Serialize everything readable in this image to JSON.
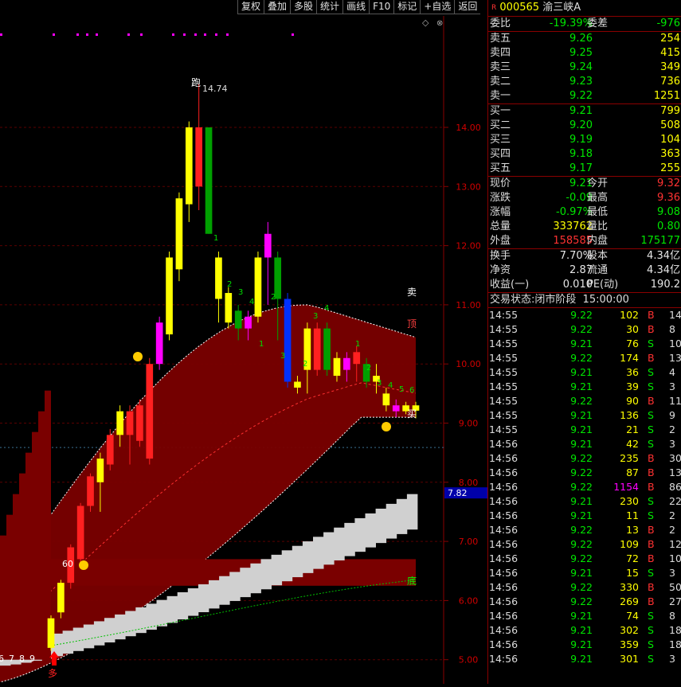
{
  "toolbar": [
    "复权",
    "叠加",
    "多股",
    "统计",
    "画线",
    "F10",
    "标记",
    "+自选",
    "返回"
  ],
  "stock": {
    "badge": "R",
    "code": "000565",
    "name": "渝三峡A"
  },
  "summary": [
    {
      "l1": "委比",
      "v1": "-19.39%",
      "c1": "green",
      "l2": "委差",
      "v2": "-976",
      "c2": "green"
    }
  ],
  "sell": [
    {
      "label": "卖五",
      "price": "9.26",
      "vol": "254"
    },
    {
      "label": "卖四",
      "price": "9.25",
      "vol": "415"
    },
    {
      "label": "卖三",
      "price": "9.24",
      "vol": "349"
    },
    {
      "label": "卖二",
      "price": "9.23",
      "vol": "736"
    },
    {
      "label": "卖一",
      "price": "9.22",
      "vol": "1251"
    }
  ],
  "buy": [
    {
      "label": "买一",
      "price": "9.21",
      "vol": "799"
    },
    {
      "label": "买二",
      "price": "9.20",
      "vol": "508"
    },
    {
      "label": "买三",
      "price": "9.19",
      "vol": "104"
    },
    {
      "label": "买四",
      "price": "9.18",
      "vol": "363"
    },
    {
      "label": "买五",
      "price": "9.17",
      "vol": "255"
    }
  ],
  "quote": [
    {
      "l1": "现价",
      "v1": "9.21",
      "c1": "green",
      "l2": "今开",
      "v2": "9.32",
      "c2": "red"
    },
    {
      "l1": "涨跌",
      "v1": "-0.09",
      "c1": "green",
      "l2": "最高",
      "v2": "9.36",
      "c2": "red"
    },
    {
      "l1": "涨幅",
      "v1": "-0.97%",
      "c1": "green",
      "l2": "最低",
      "v2": "9.08",
      "c2": "green"
    },
    {
      "l1": "总量",
      "v1": "333762",
      "c1": "yellow",
      "l2": "量比",
      "v2": "0.80",
      "c2": "green"
    },
    {
      "l1": "外盘",
      "v1": "158585",
      "c1": "red",
      "l2": "内盘",
      "v2": "175177",
      "c2": "green"
    }
  ],
  "fund": [
    {
      "l1": "换手",
      "v1": "7.70%",
      "l2": "股本",
      "v2": "4.34亿"
    },
    {
      "l1": "净资",
      "v1": "2.87",
      "l2": "流通",
      "v2": "4.34亿"
    },
    {
      "l1": "收益(一)",
      "v1": "0.010",
      "l2": "PE(动)",
      "v2": "190.2"
    }
  ],
  "status": {
    "label": "交易状态:",
    "value": "闭市阶段",
    "time": "15:00:00"
  },
  "trades": [
    [
      "14:55",
      "9.22",
      "102",
      "B",
      "14"
    ],
    [
      "14:55",
      "9.22",
      "30",
      "B",
      "8"
    ],
    [
      "14:55",
      "9.21",
      "76",
      "S",
      "10"
    ],
    [
      "14:55",
      "9.22",
      "174",
      "B",
      "13"
    ],
    [
      "14:55",
      "9.21",
      "36",
      "S",
      "4"
    ],
    [
      "14:55",
      "9.21",
      "39",
      "S",
      "3"
    ],
    [
      "14:55",
      "9.22",
      "90",
      "B",
      "11"
    ],
    [
      "14:55",
      "9.21",
      "136",
      "S",
      "9"
    ],
    [
      "14:55",
      "9.21",
      "21",
      "S",
      "2"
    ],
    [
      "14:56",
      "9.21",
      "42",
      "S",
      "3"
    ],
    [
      "14:56",
      "9.22",
      "235",
      "B",
      "30"
    ],
    [
      "14:56",
      "9.22",
      "87",
      "B",
      "13"
    ],
    [
      "14:56",
      "9.22",
      "1154",
      "B",
      "86"
    ],
    [
      "14:56",
      "9.21",
      "230",
      "S",
      "22"
    ],
    [
      "14:56",
      "9.21",
      "11",
      "S",
      "2"
    ],
    [
      "14:56",
      "9.22",
      "13",
      "B",
      "2"
    ],
    [
      "14:56",
      "9.22",
      "109",
      "B",
      "12"
    ],
    [
      "14:56",
      "9.22",
      "72",
      "B",
      "10"
    ],
    [
      "14:56",
      "9.21",
      "15",
      "S",
      "3"
    ],
    [
      "14:56",
      "9.22",
      "330",
      "B",
      "50"
    ],
    [
      "14:56",
      "9.22",
      "269",
      "B",
      "27"
    ],
    [
      "14:56",
      "9.21",
      "74",
      "S",
      "8"
    ],
    [
      "14:56",
      "9.21",
      "302",
      "S",
      "18"
    ],
    [
      "14:56",
      "9.21",
      "359",
      "S",
      "18"
    ],
    [
      "14:56",
      "9.21",
      "301",
      "S",
      "3"
    ]
  ],
  "chart_data": {
    "type": "candlestick",
    "y_ticks": [
      "14.00",
      "13.00",
      "12.00",
      "11.00",
      "10.00",
      "9.00",
      "8.00",
      "7.00",
      "6.00",
      "5.00"
    ],
    "ylim": [
      4.8,
      14.9
    ],
    "current_price_label": "7.82",
    "annotations": {
      "peak_label": "跑",
      "peak_value": "14.74",
      "sell": "卖",
      "top": "顶",
      "buy": "买",
      "bottom": "底",
      "low_label": "60",
      "bottom_marker": "多"
    },
    "left_numbers": [
      "6",
      "7",
      "8",
      "9"
    ],
    "candles": [
      {
        "o": 5.2,
        "c": 5.7,
        "h": 5.75,
        "l": 5.15,
        "col": "yellow"
      },
      {
        "o": 5.8,
        "c": 6.3,
        "h": 6.35,
        "l": 5.7,
        "col": "yellow"
      },
      {
        "o": 6.3,
        "c": 6.9,
        "h": 6.95,
        "l": 6.2,
        "col": "red"
      },
      {
        "o": 6.7,
        "c": 7.6,
        "h": 7.65,
        "l": 6.6,
        "col": "red"
      },
      {
        "o": 7.6,
        "c": 8.1,
        "h": 8.15,
        "l": 7.5,
        "col": "red"
      },
      {
        "o": 8.0,
        "c": 8.4,
        "h": 8.5,
        "l": 7.5,
        "col": "yellow"
      },
      {
        "o": 8.3,
        "c": 8.8,
        "h": 8.9,
        "l": 8.2,
        "col": "red"
      },
      {
        "o": 8.8,
        "c": 9.2,
        "h": 9.3,
        "l": 8.6,
        "col": "yellow"
      },
      {
        "o": 8.8,
        "c": 9.2,
        "h": 9.3,
        "l": 8.3,
        "col": "red"
      },
      {
        "o": 8.7,
        "c": 9.3,
        "h": 9.4,
        "l": 8.6,
        "col": "red"
      },
      {
        "o": 8.4,
        "c": 10.0,
        "h": 10.1,
        "l": 8.3,
        "col": "red"
      },
      {
        "o": 10.0,
        "c": 10.7,
        "h": 10.8,
        "l": 9.9,
        "col": "magenta"
      },
      {
        "o": 10.5,
        "c": 11.8,
        "h": 11.9,
        "l": 10.4,
        "col": "yellow"
      },
      {
        "o": 11.6,
        "c": 12.8,
        "h": 12.9,
        "l": 11.4,
        "col": "yellow"
      },
      {
        "o": 12.7,
        "c": 14.0,
        "h": 14.1,
        "l": 12.4,
        "col": "yellow"
      },
      {
        "o": 14.0,
        "c": 13.0,
        "h": 14.74,
        "l": 12.6,
        "col": "red"
      },
      {
        "o": 14.0,
        "c": 12.2,
        "h": 14.0,
        "l": 12.2,
        "col": "green"
      },
      {
        "o": 11.8,
        "c": 11.1,
        "h": 11.9,
        "l": 10.7,
        "col": "yellow"
      },
      {
        "o": 11.2,
        "c": 10.7,
        "h": 11.3,
        "l": 10.6,
        "col": "yellow"
      },
      {
        "o": 10.9,
        "c": 10.6,
        "h": 11.0,
        "l": 10.4,
        "col": "green"
      },
      {
        "o": 10.8,
        "c": 10.6,
        "h": 10.9,
        "l": 10.4,
        "col": "magenta"
      },
      {
        "o": 10.8,
        "c": 11.8,
        "h": 11.9,
        "l": 10.7,
        "col": "yellow"
      },
      {
        "o": 11.8,
        "c": 12.2,
        "h": 12.4,
        "l": 11.0,
        "col": "magenta"
      },
      {
        "o": 11.8,
        "c": 11.1,
        "h": 11.9,
        "l": 10.4,
        "col": "green"
      },
      {
        "o": 11.1,
        "c": 9.7,
        "h": 11.2,
        "l": 9.6,
        "col": "blue"
      },
      {
        "o": 9.7,
        "c": 9.6,
        "h": 9.8,
        "l": 9.5,
        "col": "yellow"
      },
      {
        "o": 9.9,
        "c": 10.6,
        "h": 10.7,
        "l": 9.5,
        "col": "yellow"
      },
      {
        "o": 10.6,
        "c": 9.9,
        "h": 10.7,
        "l": 9.8,
        "col": "red"
      },
      {
        "o": 10.6,
        "c": 9.9,
        "h": 10.7,
        "l": 9.8,
        "col": "green"
      },
      {
        "o": 10.1,
        "c": 9.8,
        "h": 10.2,
        "l": 9.7,
        "col": "yellow"
      },
      {
        "o": 9.9,
        "c": 10.1,
        "h": 10.2,
        "l": 9.7,
        "col": "magenta"
      },
      {
        "o": 10.2,
        "c": 10.0,
        "h": 10.3,
        "l": 9.7,
        "col": "red"
      },
      {
        "o": 9.7,
        "c": 10.0,
        "h": 10.1,
        "l": 9.6,
        "col": "green"
      },
      {
        "o": 9.8,
        "c": 9.7,
        "h": 10.0,
        "l": 9.5,
        "col": "yellow"
      },
      {
        "o": 9.5,
        "c": 9.3,
        "h": 9.6,
        "l": 9.2,
        "col": "yellow"
      },
      {
        "o": 9.3,
        "c": 9.2,
        "h": 9.4,
        "l": 9.1,
        "col": "magenta"
      },
      {
        "o": 9.3,
        "c": 9.2,
        "h": 9.36,
        "l": 9.15,
        "col": "yellow"
      },
      {
        "o": 9.3,
        "c": 9.21,
        "h": 9.36,
        "l": 9.08,
        "col": "yellow"
      }
    ]
  }
}
